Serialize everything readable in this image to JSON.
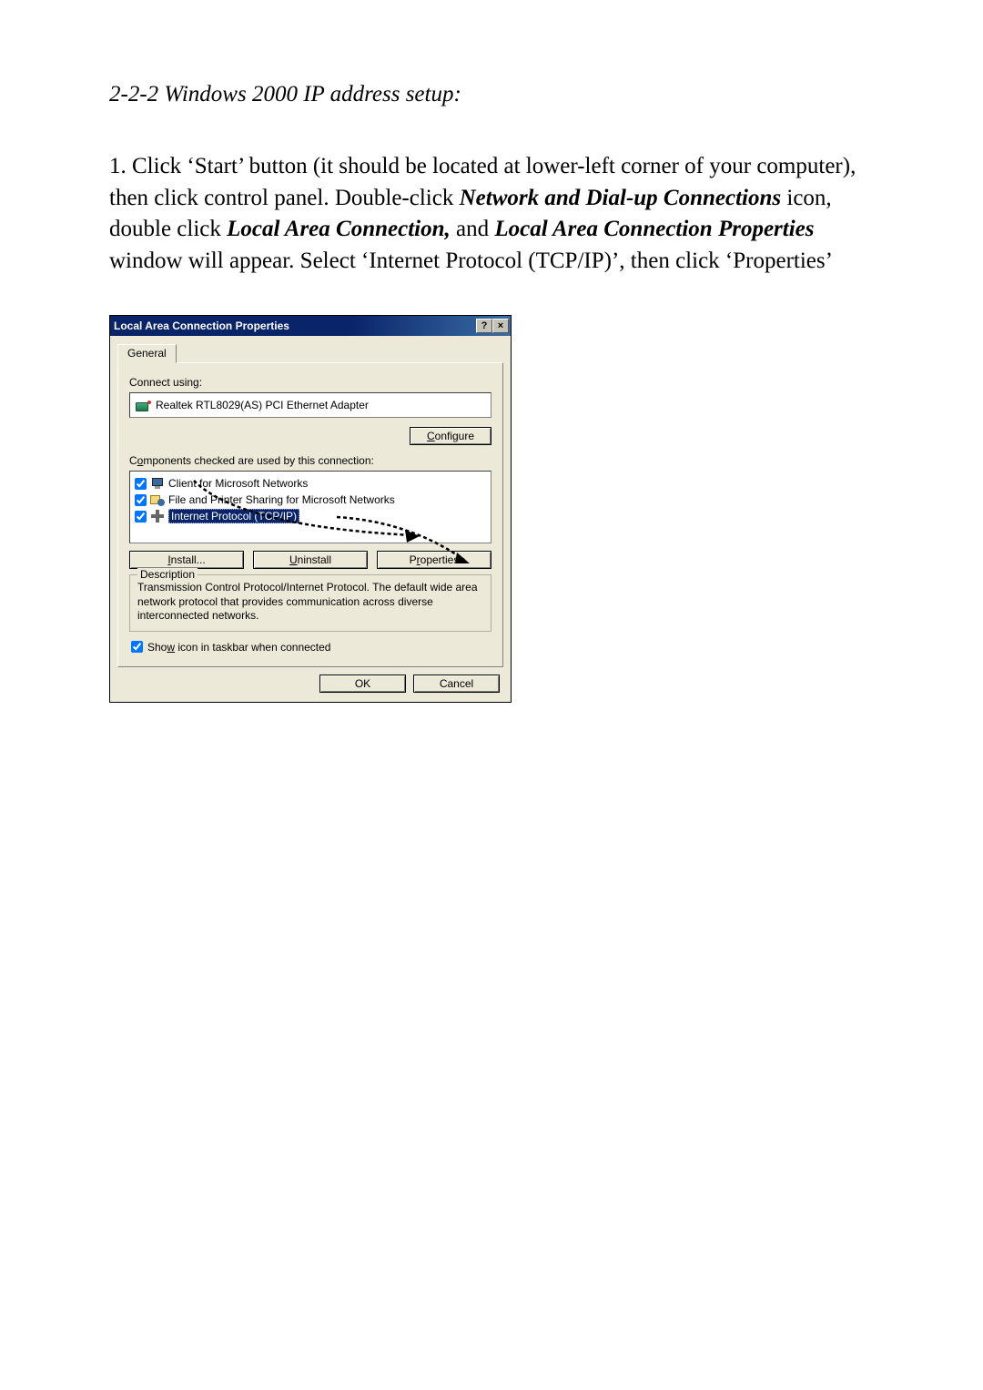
{
  "doc": {
    "heading": "2-2-2 Windows 2000 IP address setup:",
    "instruction_pre": "1. Click ‘Start’ button (it should be located at lower-left corner of your computer), then click control panel. Double-click ",
    "bold1": "Network and Dial-up Connections",
    "instruction_mid1": " icon, double click ",
    "bold2": "Local Area Connection,",
    "instruction_mid2": " and ",
    "bold3": "Local Area Connection Properties",
    "instruction_post": " window will appear. Select ‘Internet Protocol (TCP/IP)’, then click ‘Properties’"
  },
  "dialog": {
    "title": "Local Area Connection Properties",
    "help_btn": "?",
    "close_btn": "×",
    "tab_general": "General",
    "connect_using_label": "Connect using:",
    "adapter_name": "Realtek RTL8029(AS) PCI Ethernet Adapter",
    "configure_btn": "Configure",
    "configure_u": "C",
    "components_label_pre": "C",
    "components_label_u": "o",
    "components_label_post": "mponents checked are used by this connection:",
    "comp1": "Client for Microsoft Networks",
    "comp2": "File and Printer Sharing for Microsoft Networks",
    "comp3": "Internet Protocol (TCP/IP)",
    "install_pre": "",
    "install_u": "I",
    "install_post": "nstall...",
    "uninstall_pre": "",
    "uninstall_u": "U",
    "uninstall_post": "ninstall",
    "properties_pre": "P",
    "properties_u": "r",
    "properties_post": "operties",
    "desc_legend": "Description",
    "desc_text": "Transmission Control Protocol/Internet Protocol. The default wide area network protocol that provides communication across diverse interconnected networks.",
    "show_icon_pre": "Sho",
    "show_icon_u": "w",
    "show_icon_post": " icon in taskbar when connected",
    "ok_btn": "OK",
    "cancel_btn": "Cancel"
  }
}
